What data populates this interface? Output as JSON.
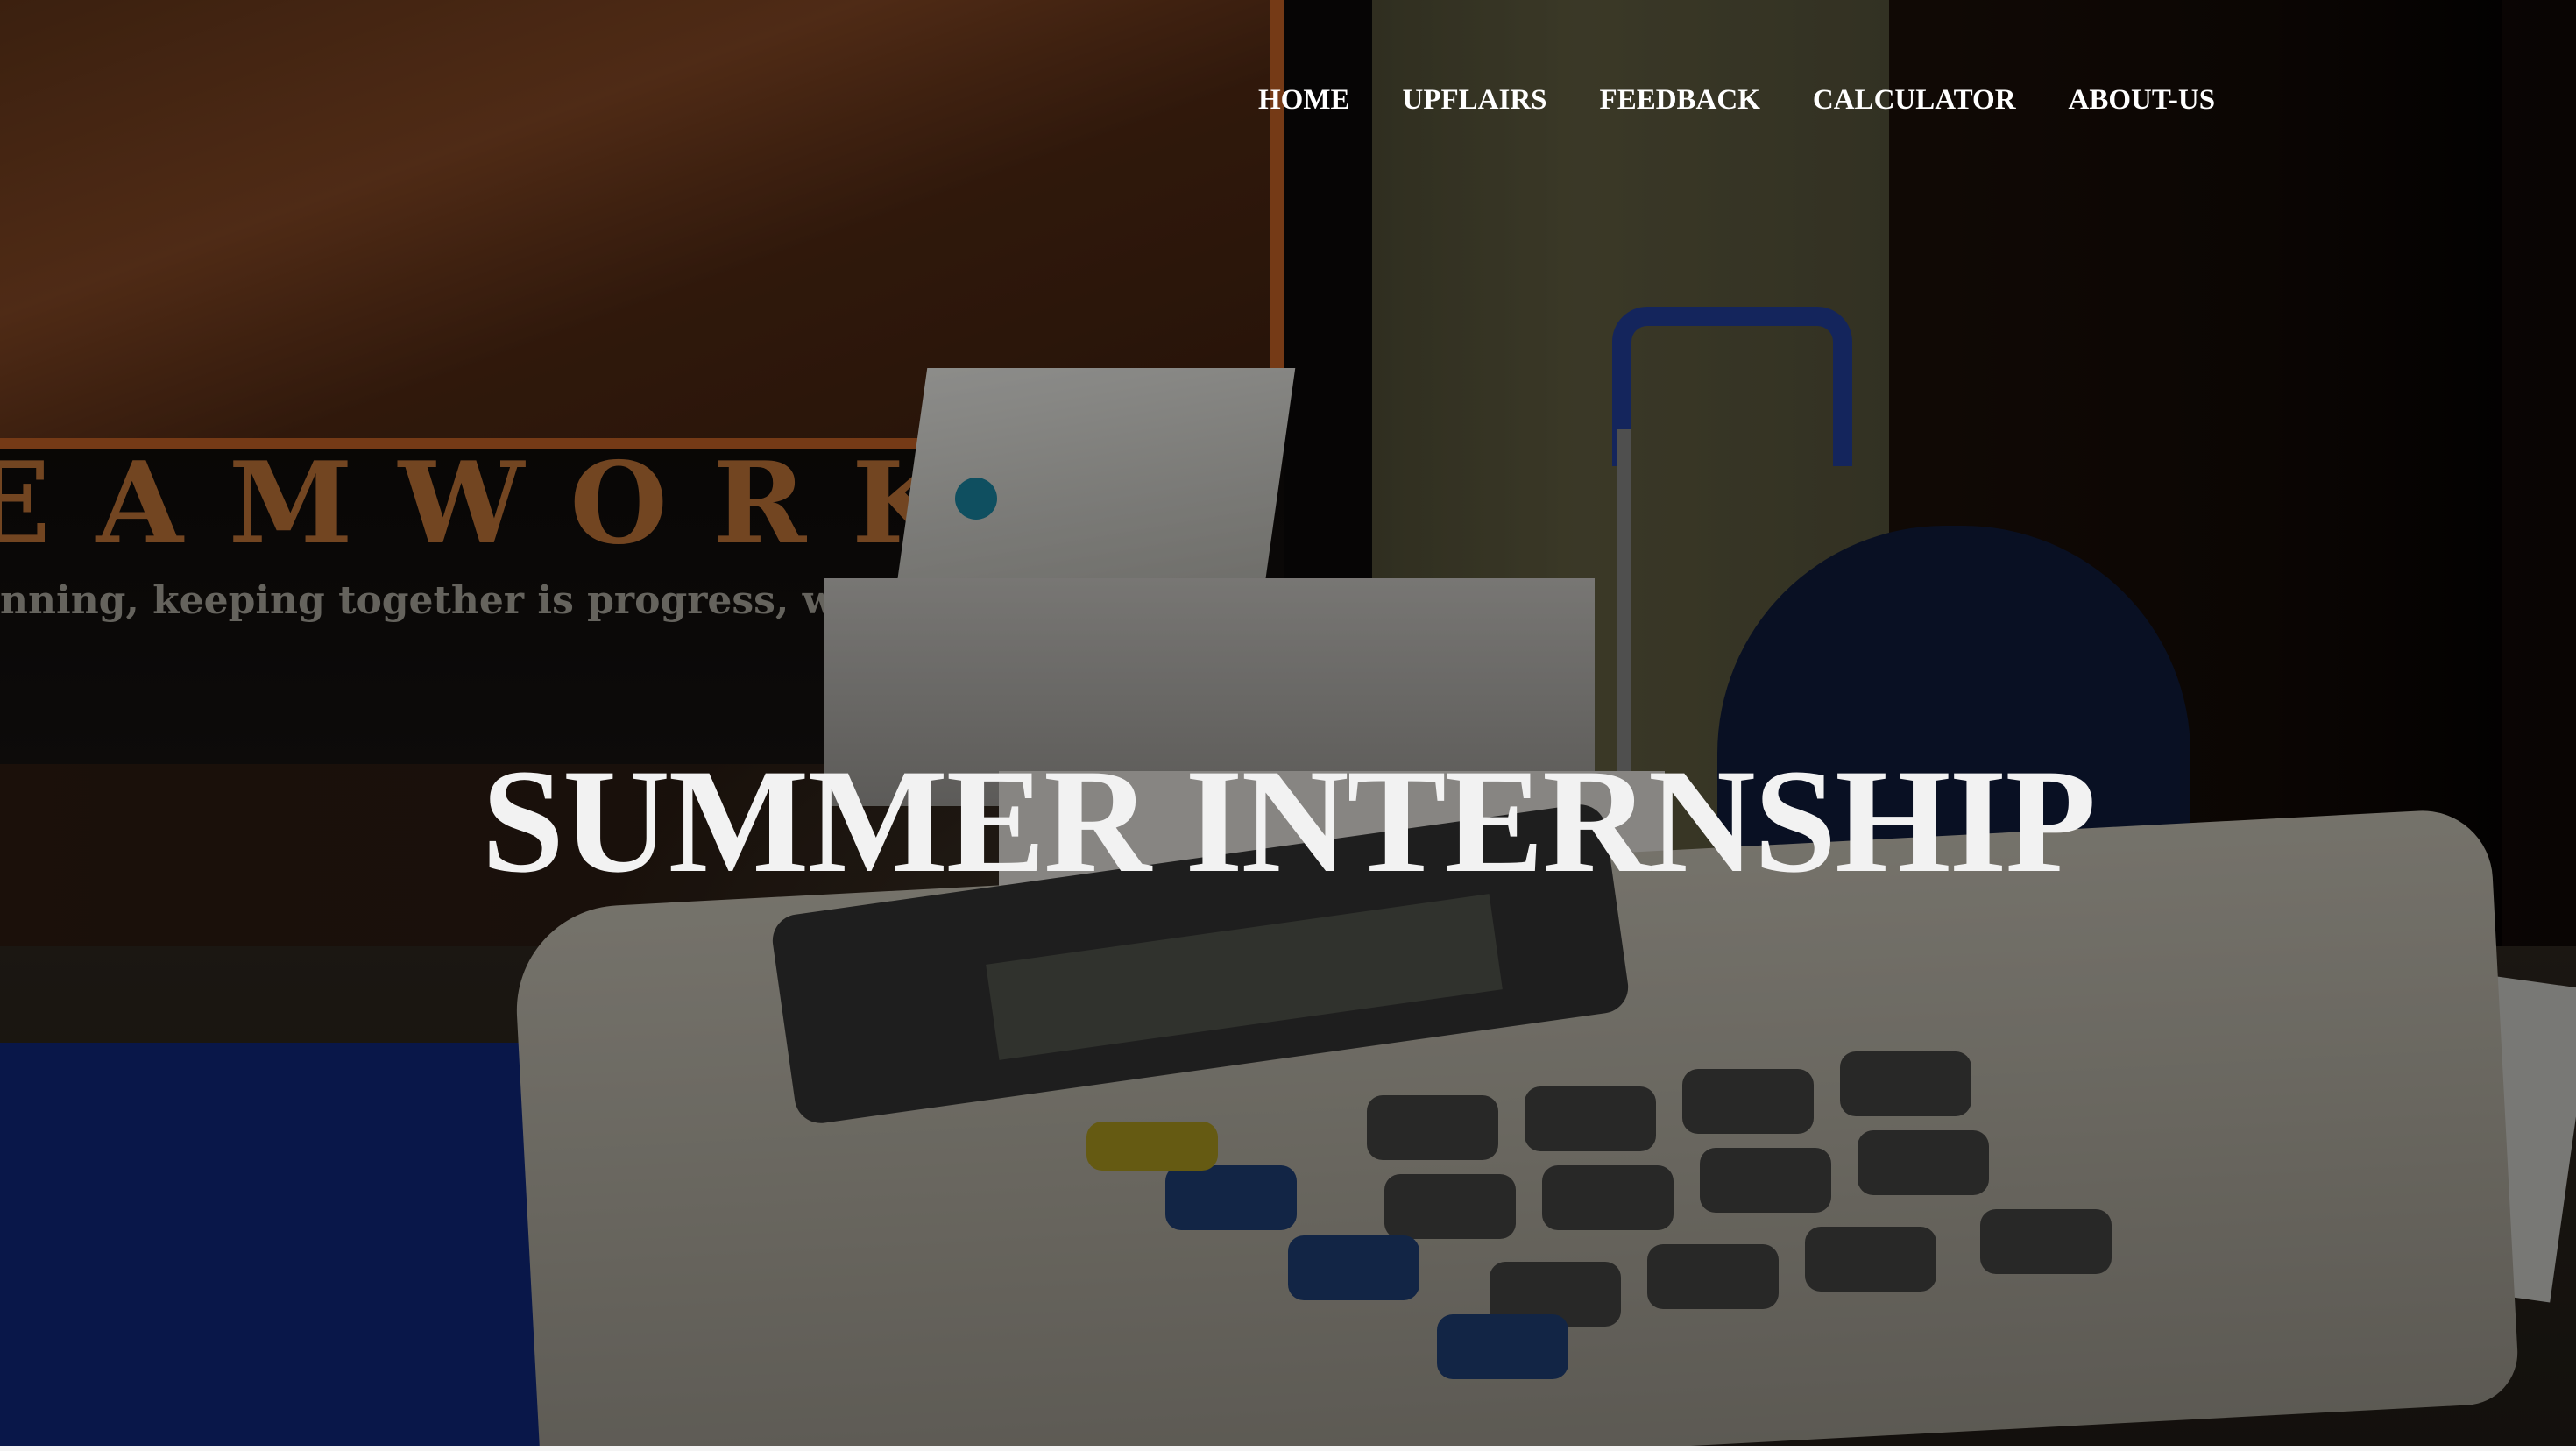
{
  "nav": {
    "items": [
      {
        "label": "HOME"
      },
      {
        "label": "UPFLAIRS"
      },
      {
        "label": "FEEDBACK"
      },
      {
        "label": "CALCULATOR"
      },
      {
        "label": "ABOUT-US"
      }
    ]
  },
  "hero": {
    "title": "SUMMER INTERNSHIP",
    "background_poster_word": "EAMWORK",
    "background_poster_subtitle": "nning, keeping together is progress, working tog",
    "accent_dot_color": "#0f4f60"
  }
}
